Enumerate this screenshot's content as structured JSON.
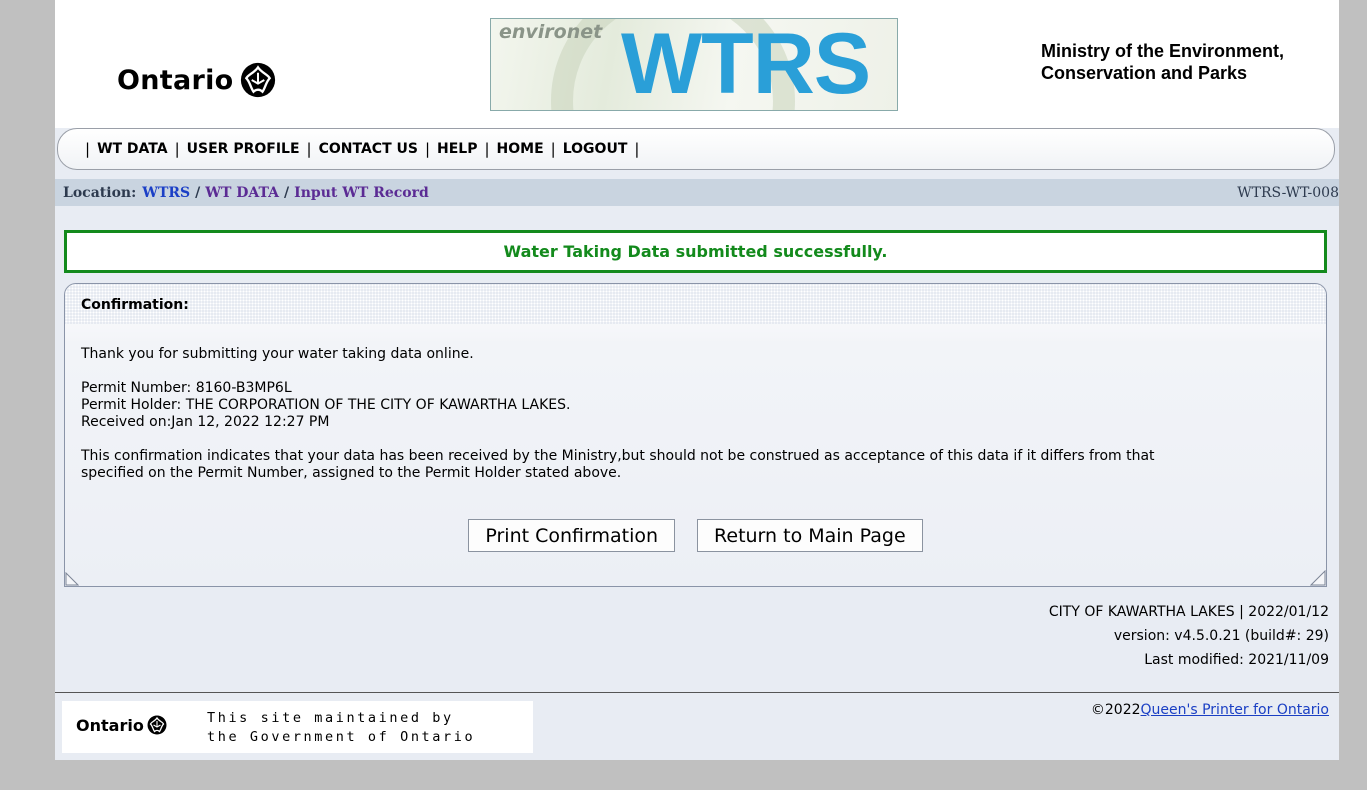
{
  "header": {
    "ontario_logo_text": "Ontario",
    "banner_small": "environet",
    "banner_big": "WTRS",
    "ministry_line1": "Ministry of the Environment,",
    "ministry_line2": "Conservation and Parks"
  },
  "nav": {
    "items": [
      "WT DATA",
      "USER PROFILE",
      "CONTACT US",
      "HELP",
      "HOME",
      "LOGOUT"
    ]
  },
  "breadcrumb": {
    "label": "Location:",
    "items": [
      "WTRS",
      "WT DATA",
      "Input WT Record"
    ],
    "page_id": "WTRS-WT-008"
  },
  "success_message": "Water Taking Data submitted successfully.",
  "confirmation": {
    "title": "Confirmation:",
    "thank_you": "Thank you for submitting your water taking data online.",
    "permit_number": "Permit Number: 8160-B3MP6L",
    "permit_holder": "Permit Holder: THE CORPORATION OF THE CITY OF KAWARTHA LAKES.",
    "received_on": "Received on:Jan 12, 2022 12:27 PM",
    "disclaimer_line1": "This confirmation indicates that your data has been received by the Ministry,but should not be construed as acceptance of this data if it differs from that",
    "disclaimer_line2": "specified on the Permit Number, assigned to the Permit Holder stated above.",
    "print_button": "Print Confirmation",
    "return_button": "Return to Main Page"
  },
  "footer": {
    "org_date": "CITY OF KAWARTHA LAKES | 2022/01/12",
    "version": "version: v4.5.0.21 (build#: 29)",
    "last_modified": "Last modified: 2021/11/09",
    "maint_logo_text": "Ontario",
    "maint_line1": "This site maintained by",
    "maint_line2": "the Government of Ontario",
    "copyright_prefix": "©2022",
    "copyright_link": "Queen's Printer for Ontario"
  },
  "colors": {
    "success_green": "#138a1c",
    "wtrs_blue": "#2a9fd8",
    "link_blue": "#1b3fc6",
    "visited_purple": "#5b2b94"
  }
}
